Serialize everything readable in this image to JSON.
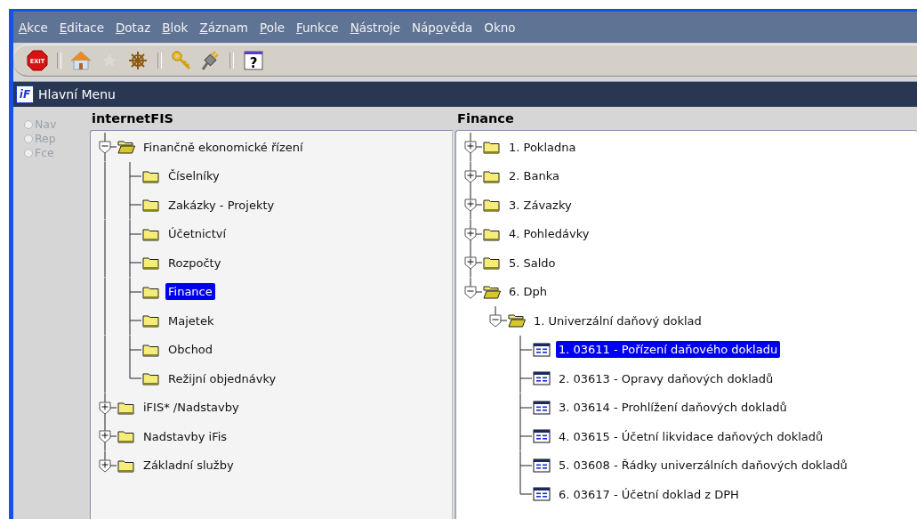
{
  "menu": [
    {
      "key": "A",
      "post": "kce"
    },
    {
      "key": "E",
      "post": "ditace"
    },
    {
      "key": "D",
      "post": "otaz"
    },
    {
      "key": "B",
      "post": "lok"
    },
    {
      "key": "Z",
      "post": "áznam"
    },
    {
      "key": "P",
      "post": "ole"
    },
    {
      "key": "F",
      "post": "unkce"
    },
    {
      "key": "N",
      "post": "ástroje"
    },
    {
      "pre": "Náp",
      "key": "o",
      "post": "věda"
    },
    {
      "pre": "Okno"
    }
  ],
  "toolbar": [
    {
      "kind": "button",
      "label": "EXIT",
      "disabled": false
    },
    {
      "kind": "separator"
    },
    {
      "kind": "button",
      "disabled": false
    },
    {
      "kind": "button",
      "disabled": true
    },
    {
      "kind": "button",
      "disabled": false
    },
    {
      "kind": "separator"
    },
    {
      "kind": "button",
      "disabled": false
    },
    {
      "kind": "button",
      "disabled": false
    },
    {
      "kind": "separator"
    },
    {
      "kind": "button",
      "label": "?",
      "disabled": false
    }
  ],
  "window": {
    "logo": "iF",
    "title": "Hlavní Menu"
  },
  "modes": [
    {
      "label": "Nav",
      "selected": false,
      "disabled": true
    },
    {
      "label": "Rep",
      "selected": false,
      "disabled": true
    },
    {
      "label": "Fce",
      "selected": false,
      "disabled": true
    }
  ],
  "left_tree": {
    "title": "internetFIS",
    "items": [
      {
        "label": "Finančně ekonomické řízení",
        "kind": "folder",
        "expanded": true,
        "selected": false,
        "children": [
          {
            "label": "Číselníky",
            "kind": "folder",
            "selected": false
          },
          {
            "label": "Zakázky - Projekty",
            "kind": "folder",
            "selected": false
          },
          {
            "label": "Účetnictví",
            "kind": "folder",
            "selected": false
          },
          {
            "label": "Rozpočty",
            "kind": "folder",
            "selected": false
          },
          {
            "label": "Finance",
            "kind": "folder",
            "selected": true
          },
          {
            "label": "Majetek",
            "kind": "folder",
            "selected": false
          },
          {
            "label": "Obchod",
            "kind": "folder",
            "selected": false
          },
          {
            "label": "Režijní objednávky",
            "kind": "folder",
            "selected": false
          }
        ]
      },
      {
        "label": "iFIS* /Nadstavby",
        "kind": "folder",
        "expanded": false,
        "selected": false
      },
      {
        "label": "Nadstavby iFis",
        "kind": "folder",
        "expanded": false,
        "selected": false
      },
      {
        "label": "Základní služby",
        "kind": "folder",
        "expanded": false,
        "selected": false
      }
    ]
  },
  "right_tree": {
    "title": "Finance",
    "items": [
      {
        "label": "1.  Pokladna",
        "kind": "folder",
        "expanded": false,
        "selected": false
      },
      {
        "label": "2.  Banka",
        "kind": "folder",
        "expanded": false,
        "selected": false
      },
      {
        "label": "3.  Závazky",
        "kind": "folder",
        "expanded": false,
        "selected": false
      },
      {
        "label": "4.  Pohledávky",
        "kind": "folder",
        "expanded": false,
        "selected": false
      },
      {
        "label": "5.  Saldo",
        "kind": "folder",
        "expanded": false,
        "selected": false
      },
      {
        "label": "6.  Dph",
        "kind": "folder",
        "expanded": true,
        "selected": false,
        "children": [
          {
            "label": "1.  Univerzální daňový doklad",
            "kind": "folder",
            "expanded": true,
            "selected": false,
            "children": [
              {
                "label": "1.  03611 - Pořízení daňového dokladu",
                "kind": "form",
                "selected": true
              },
              {
                "label": "2.  03613 - Opravy daňových dokladů",
                "kind": "form",
                "selected": false
              },
              {
                "label": "3.  03614 - Prohlížení daňových dokladů",
                "kind": "form",
                "selected": false
              },
              {
                "label": "4.  03615 - Účetní likvidace daňových dokladů",
                "kind": "form",
                "selected": false
              },
              {
                "label": "5.  03608 - Řádky univerzálních daňových dokladů",
                "kind": "form",
                "selected": false
              },
              {
                "label": "6.  03617 - Účetní doklad z DPH",
                "kind": "form",
                "selected": false
              }
            ]
          }
        ]
      }
    ]
  }
}
